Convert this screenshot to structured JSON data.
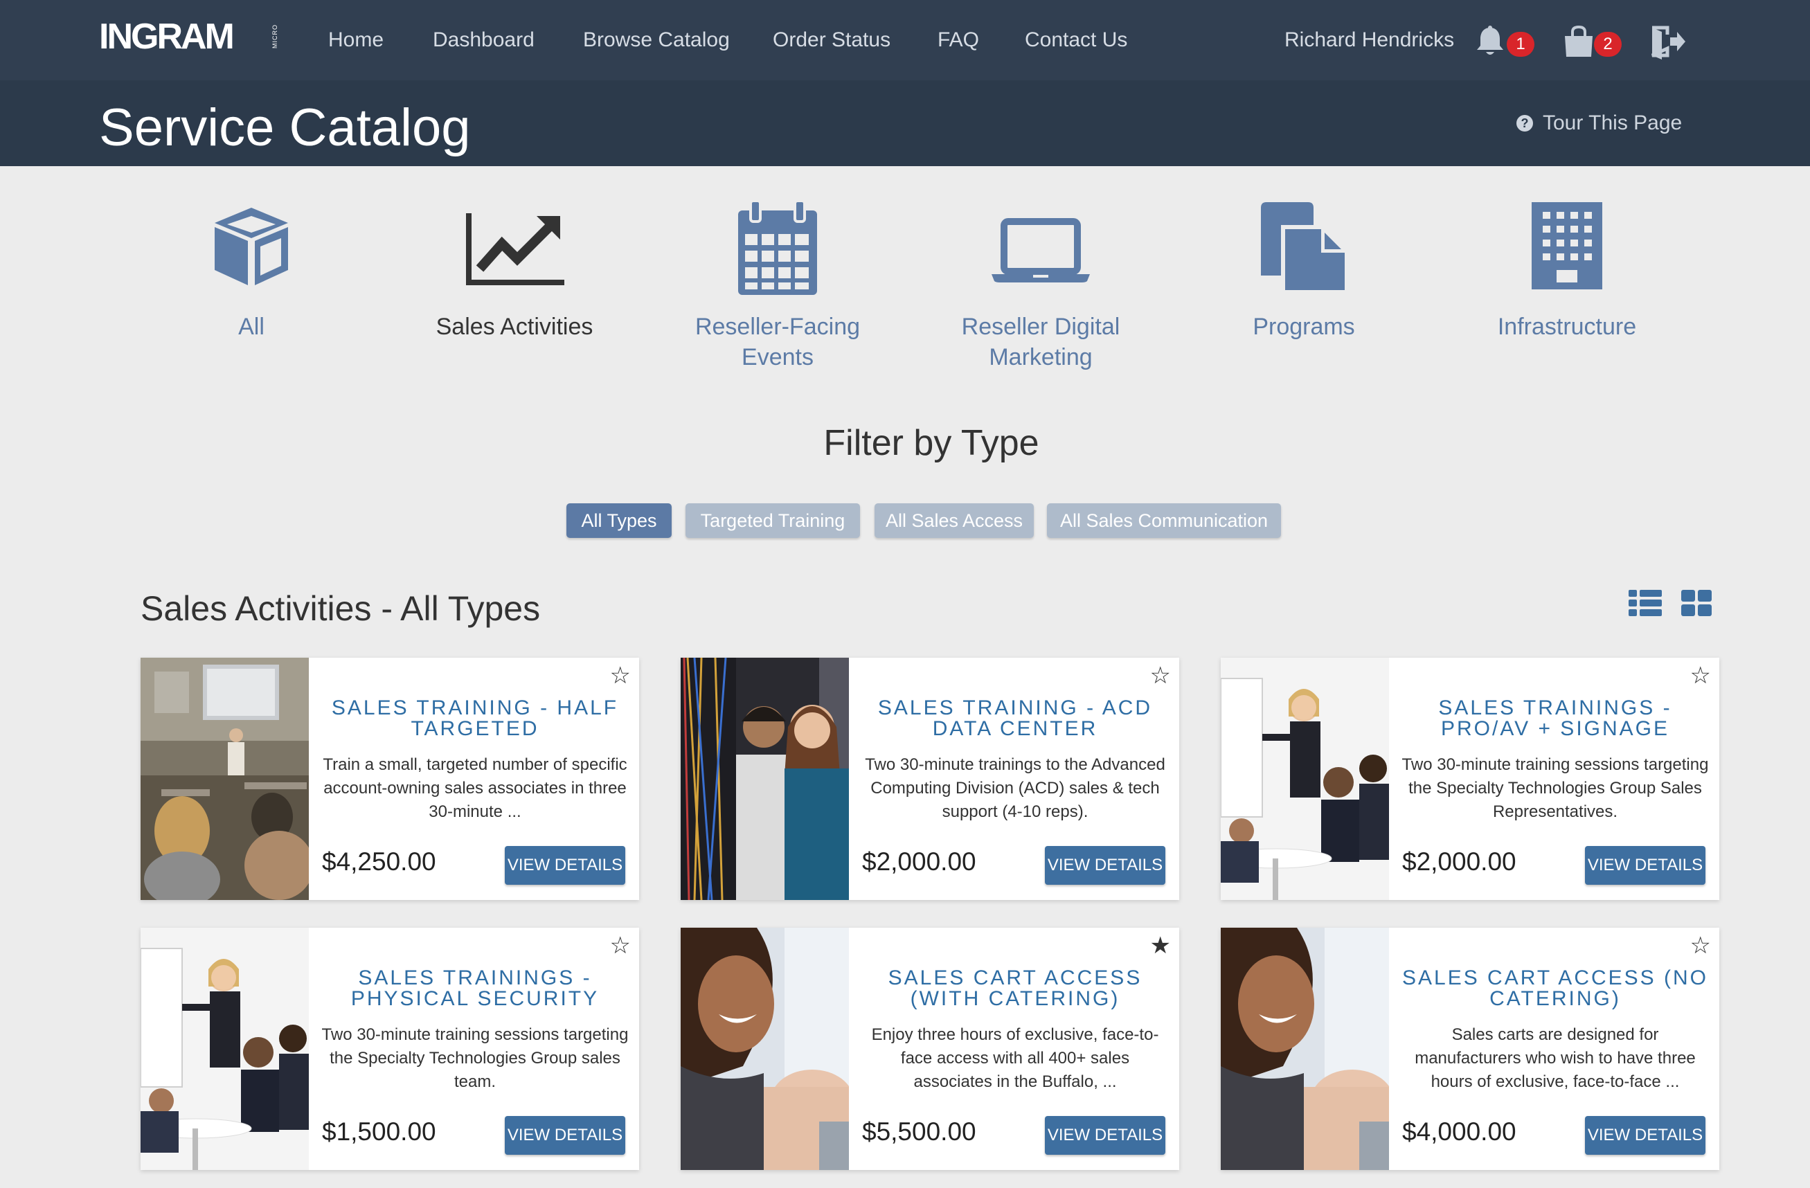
{
  "header": {
    "logo": "INGRAM",
    "logo_sub": "MICRO",
    "nav": [
      "Home",
      "Dashboard",
      "Browse Catalog",
      "Order Status",
      "FAQ",
      "Contact Us"
    ],
    "user_name": "Richard Hendricks",
    "notifications_count": "1",
    "cart_count": "2",
    "icons": [
      "bell-icon",
      "shopping-bag-icon",
      "logout-icon"
    ]
  },
  "titlebar": {
    "title": "Service Catalog",
    "tour": "Tour This Page"
  },
  "categories": [
    {
      "label": "All",
      "icon": "cube-icon"
    },
    {
      "label": "Sales Activities",
      "icon": "chart-line-icon",
      "active": true
    },
    {
      "label": "Reseller-Facing Events",
      "icon": "calendar-icon"
    },
    {
      "label": "Reseller Digital Marketing",
      "icon": "laptop-icon"
    },
    {
      "label": "Programs",
      "icon": "documents-icon"
    },
    {
      "label": "Infrastructure",
      "icon": "building-icon"
    }
  ],
  "filter": {
    "title": "Filter by Type",
    "pills": [
      "All Types",
      "Targeted Training",
      "All Sales Access",
      "All Sales Communication"
    ],
    "active": "All Types"
  },
  "section": {
    "title": "Sales Activities - All Types",
    "view_icons": [
      "list-view-icon",
      "grid-view-icon"
    ]
  },
  "colors": {
    "topbar": "#313f51",
    "titlebar": "#2c3a4b",
    "accent": "#3e6fa0",
    "category": "#5c7ba6",
    "pill": "#aebbcb",
    "pill_active": "#5c7aa5"
  },
  "cards": [
    {
      "title": "Sales Training - Half Targeted",
      "desc": "Train a small, targeted number of specific account-owning sales associates in three 30-minute ...",
      "price": "$4,250.00",
      "button": "VIEW DETAILS",
      "starred": false
    },
    {
      "title": "Sales Training - ACD Data Center",
      "desc": "Two 30-minute trainings to the Advanced Computing Division (ACD) sales & tech support (4-10 reps).",
      "price": "$2,000.00",
      "button": "VIEW DETAILS",
      "starred": false
    },
    {
      "title": "Sales Trainings - Pro/AV + Signage",
      "desc": "Two 30-minute training sessions targeting the Specialty Technologies Group Sales Representatives.",
      "price": "$2,000.00",
      "button": "VIEW DETAILS",
      "starred": false
    },
    {
      "title": "Sales Trainings - Physical Security",
      "desc": "Two 30-minute training sessions targeting the Specialty Technologies Group sales team.",
      "price": "$1,500.00",
      "button": "VIEW DETAILS",
      "starred": false
    },
    {
      "title": "Sales Cart Access (with Catering)",
      "desc": "Enjoy three hours of exclusive, face-to-face access with all 400+ sales associates in the Buffalo, ...",
      "price": "$5,500.00",
      "button": "VIEW DETAILS",
      "starred": true
    },
    {
      "title": "Sales Cart Access (no Catering)",
      "desc": "Sales carts are designed for manufacturers who wish to have three hours of exclusive, face-to-face ...",
      "price": "$4,000.00",
      "button": "VIEW DETAILS",
      "starred": false
    }
  ]
}
